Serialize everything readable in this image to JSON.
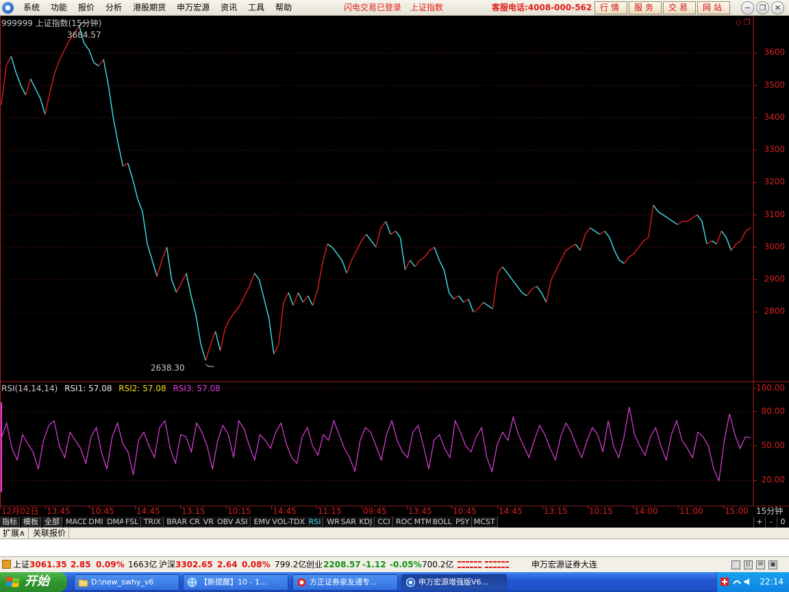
{
  "menubar": {
    "items": [
      "系统",
      "功能",
      "报价",
      "分析",
      "港股期货",
      "申万宏源",
      "资讯",
      "工具",
      "帮助"
    ],
    "login_status": "闪电交易已登录",
    "index_name": "上证指数",
    "hotline": "客服电话:4008-000-562",
    "quick_buttons": [
      "行情",
      "服务",
      "交易",
      "网站"
    ]
  },
  "chart": {
    "title": "999999 上证指数(15分钟)",
    "high_label": "3684.57",
    "low_label": "2638.30",
    "rsi_label": "RSI(14,14,14)",
    "rsi1": "RSI1: 57.08",
    "rsi2": "RSI2: 57.08",
    "rsi3": "RSI3: 57.08",
    "period_label": "15分钟"
  },
  "chart_data": {
    "type": "line",
    "title": "999999 上证指数(15分钟)",
    "price_axis_ticks": [
      "3600",
      "3500",
      "3400",
      "3300",
      "3200",
      "3100",
      "3000",
      "2900",
      "2800"
    ],
    "rsi_axis_ticks": [
      "100.00",
      "80.00",
      "50.00",
      "20.00"
    ],
    "time_labels": [
      "12月02日",
      "13:45",
      "10:45",
      "14:45",
      "13:15",
      "10:15",
      "14:45",
      "11:15",
      "09:45",
      "13:45",
      "10:45",
      "14:45",
      "13:15",
      "10:15",
      "14:00",
      "11:00",
      "15:00"
    ],
    "price_ylim": [
      2600,
      3700
    ],
    "rsi_ylim": [
      0,
      100
    ],
    "high": 3684.57,
    "low": 2638.3,
    "price_series": [
      [
        0,
        3440
      ],
      [
        2,
        3560
      ],
      [
        4,
        3590
      ],
      [
        6,
        3540
      ],
      [
        8,
        3500
      ],
      [
        10,
        3470
      ],
      [
        12,
        3520
      ],
      [
        14,
        3490
      ],
      [
        16,
        3460
      ],
      [
        18,
        3410
      ],
      [
        20,
        3480
      ],
      [
        22,
        3540
      ],
      [
        24,
        3580
      ],
      [
        26,
        3610
      ],
      [
        28,
        3640
      ],
      [
        30,
        3660
      ],
      [
        32,
        3684
      ],
      [
        34,
        3630
      ],
      [
        36,
        3610
      ],
      [
        38,
        3570
      ],
      [
        40,
        3560
      ],
      [
        42,
        3580
      ],
      [
        44,
        3500
      ],
      [
        46,
        3400
      ],
      [
        48,
        3320
      ],
      [
        50,
        3250
      ],
      [
        52,
        3260
      ],
      [
        54,
        3210
      ],
      [
        56,
        3150
      ],
      [
        58,
        3110
      ],
      [
        60,
        3010
      ],
      [
        62,
        2960
      ],
      [
        64,
        2910
      ],
      [
        66,
        2960
      ],
      [
        68,
        3000
      ],
      [
        70,
        2900
      ],
      [
        72,
        2860
      ],
      [
        74,
        2890
      ],
      [
        76,
        2920
      ],
      [
        78,
        2850
      ],
      [
        80,
        2790
      ],
      [
        82,
        2700
      ],
      [
        84,
        2650
      ],
      [
        86,
        2700
      ],
      [
        88,
        2740
      ],
      [
        90,
        2680
      ],
      [
        92,
        2750
      ],
      [
        94,
        2780
      ],
      [
        96,
        2800
      ],
      [
        98,
        2820
      ],
      [
        100,
        2850
      ],
      [
        102,
        2880
      ],
      [
        104,
        2920
      ],
      [
        106,
        2900
      ],
      [
        108,
        2840
      ],
      [
        110,
        2780
      ],
      [
        112,
        2670
      ],
      [
        114,
        2700
      ],
      [
        116,
        2830
      ],
      [
        118,
        2860
      ],
      [
        120,
        2820
      ],
      [
        122,
        2860
      ],
      [
        124,
        2830
      ],
      [
        126,
        2850
      ],
      [
        128,
        2820
      ],
      [
        130,
        2870
      ],
      [
        132,
        2950
      ],
      [
        134,
        3010
      ],
      [
        136,
        3000
      ],
      [
        138,
        2980
      ],
      [
        140,
        2960
      ],
      [
        142,
        2920
      ],
      [
        144,
        2960
      ],
      [
        146,
        2990
      ],
      [
        148,
        3020
      ],
      [
        150,
        3040
      ],
      [
        152,
        3020
      ],
      [
        154,
        3000
      ],
      [
        156,
        3060
      ],
      [
        158,
        3080
      ],
      [
        160,
        3040
      ],
      [
        162,
        3050
      ],
      [
        164,
        3030
      ],
      [
        166,
        2930
      ],
      [
        168,
        2960
      ],
      [
        170,
        2940
      ],
      [
        172,
        2960
      ],
      [
        174,
        2970
      ],
      [
        176,
        2990
      ],
      [
        178,
        3000
      ],
      [
        180,
        2960
      ],
      [
        182,
        2930
      ],
      [
        184,
        2860
      ],
      [
        186,
        2840
      ],
      [
        188,
        2850
      ],
      [
        190,
        2830
      ],
      [
        192,
        2840
      ],
      [
        194,
        2800
      ],
      [
        196,
        2810
      ],
      [
        198,
        2830
      ],
      [
        200,
        2820
      ],
      [
        202,
        2810
      ],
      [
        204,
        2920
      ],
      [
        206,
        2940
      ],
      [
        208,
        2920
      ],
      [
        210,
        2900
      ],
      [
        212,
        2880
      ],
      [
        214,
        2860
      ],
      [
        216,
        2850
      ],
      [
        218,
        2870
      ],
      [
        220,
        2880
      ],
      [
        222,
        2860
      ],
      [
        224,
        2830
      ],
      [
        226,
        2900
      ],
      [
        228,
        2930
      ],
      [
        230,
        2960
      ],
      [
        232,
        2990
      ],
      [
        234,
        3000
      ],
      [
        236,
        3010
      ],
      [
        238,
        2990
      ],
      [
        240,
        3040
      ],
      [
        242,
        3060
      ],
      [
        244,
        3050
      ],
      [
        246,
        3040
      ],
      [
        248,
        3050
      ],
      [
        250,
        3030
      ],
      [
        252,
        2990
      ],
      [
        254,
        2960
      ],
      [
        256,
        2950
      ],
      [
        258,
        2970
      ],
      [
        260,
        2980
      ],
      [
        262,
        3000
      ],
      [
        264,
        3020
      ],
      [
        266,
        3030
      ],
      [
        268,
        3130
      ],
      [
        270,
        3110
      ],
      [
        272,
        3100
      ],
      [
        274,
        3090
      ],
      [
        276,
        3080
      ],
      [
        278,
        3070
      ],
      [
        280,
        3080
      ],
      [
        282,
        3080
      ],
      [
        284,
        3090
      ],
      [
        286,
        3100
      ],
      [
        288,
        3080
      ],
      [
        290,
        3010
      ],
      [
        292,
        3020
      ],
      [
        294,
        3010
      ],
      [
        296,
        3050
      ],
      [
        298,
        3030
      ],
      [
        300,
        2990
      ],
      [
        302,
        3010
      ],
      [
        304,
        3020
      ],
      [
        306,
        3050
      ],
      [
        308,
        3061
      ]
    ],
    "rsi_series": [
      57,
      70,
      48,
      38,
      60,
      52,
      45,
      30,
      55,
      68,
      72,
      50,
      40,
      62,
      55,
      48,
      35,
      58,
      66,
      44,
      30,
      58,
      70,
      52,
      45,
      25,
      55,
      62,
      50,
      40,
      66,
      72,
      48,
      35,
      60,
      58,
      45,
      70,
      62,
      50,
      30,
      55,
      68,
      60,
      40,
      72,
      65,
      50,
      38,
      60,
      55,
      48,
      62,
      70,
      52,
      40,
      35,
      58,
      66,
      50,
      42,
      60,
      55,
      72,
      60,
      48,
      40,
      28,
      55,
      66,
      62,
      50,
      38,
      60,
      72,
      55,
      45,
      40,
      62,
      68,
      50,
      30,
      55,
      60,
      48,
      40,
      72,
      62,
      50,
      45,
      58,
      66,
      40,
      28,
      52,
      62,
      55,
      75,
      60,
      50,
      40,
      55,
      68,
      60,
      48,
      38,
      58,
      70,
      62,
      50,
      40,
      55,
      66,
      60,
      45,
      72,
      50,
      40,
      58,
      84,
      60,
      50,
      42,
      58,
      66,
      50,
      38,
      60,
      72,
      55,
      48,
      40,
      62,
      58,
      50,
      30,
      20,
      55,
      78,
      60,
      48,
      58,
      57
    ]
  },
  "indicator_tabs": {
    "cn": [
      "指标",
      "模板",
      "全部"
    ],
    "items": [
      "MACD",
      "DMI",
      "DMA",
      "FSL",
      "TRIX",
      "BRAR",
      "CR",
      "VR",
      "OBV",
      "ASI",
      "EMV",
      "VOL-TDX",
      "RSI",
      "WR",
      "SAR",
      "KDJ",
      "CCI",
      "ROC",
      "MTM",
      "BOLL",
      "PSY",
      "MCST"
    ],
    "active": "RSI",
    "zoom": [
      "+",
      "-",
      "0"
    ]
  },
  "sub_tabs": [
    "扩展∧",
    "关联报价"
  ],
  "statusbar": {
    "sh_label": "上证",
    "sh_value": "3061.35",
    "sh_change": "2.85",
    "sh_pct": "0.09%",
    "sh_amount": "1663亿",
    "hs_label": "沪深",
    "hs_value": "3302.65",
    "hs_change": "2.64",
    "hs_pct": "0.08%",
    "hs_amount": "799.2亿",
    "cy_label": "创业",
    "cy_value": "2208.57",
    "cy_change": "-1.12",
    "cy_pct": "-0.05%",
    "cy_amount": "700.2亿",
    "broker": "申万宏源证券大连"
  },
  "taskbar": {
    "start": "开始",
    "tasks": [
      "D:\\new_swhy_v6",
      "【新提醒】10 - 1...",
      "方正证券泉友通专...",
      "申万宏源增强版V6..."
    ],
    "clock": "22:14"
  },
  "colors": {
    "up": "#e02020",
    "down": "#40e8f0",
    "rsi": "#e040e0",
    "grid": "#8b1a1a"
  }
}
